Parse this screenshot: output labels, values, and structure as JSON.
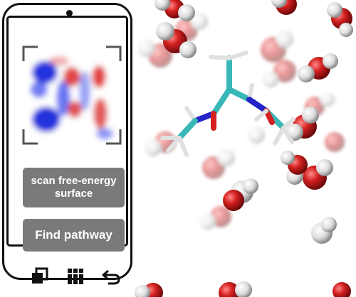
{
  "screen": {
    "image": "free-energy-surface-heatmap",
    "scan_button_label": "scan free-energy surface",
    "find_pathway_button_label": "Find pathway"
  },
  "navbar": {
    "icons": [
      "recent-apps-icon",
      "app-grid-icon",
      "back-icon"
    ]
  },
  "colors": {
    "phone_outline": "#111111",
    "button_fill": "#7a7a7a",
    "button_text": "#ffffff",
    "fes_blue": "#2233dd",
    "fes_red": "#dd2222",
    "carbon": "#39b7b7",
    "nitrogen": "#2424c8",
    "oxygen": "#d42020",
    "hydrogen": "#e8e8e8"
  }
}
